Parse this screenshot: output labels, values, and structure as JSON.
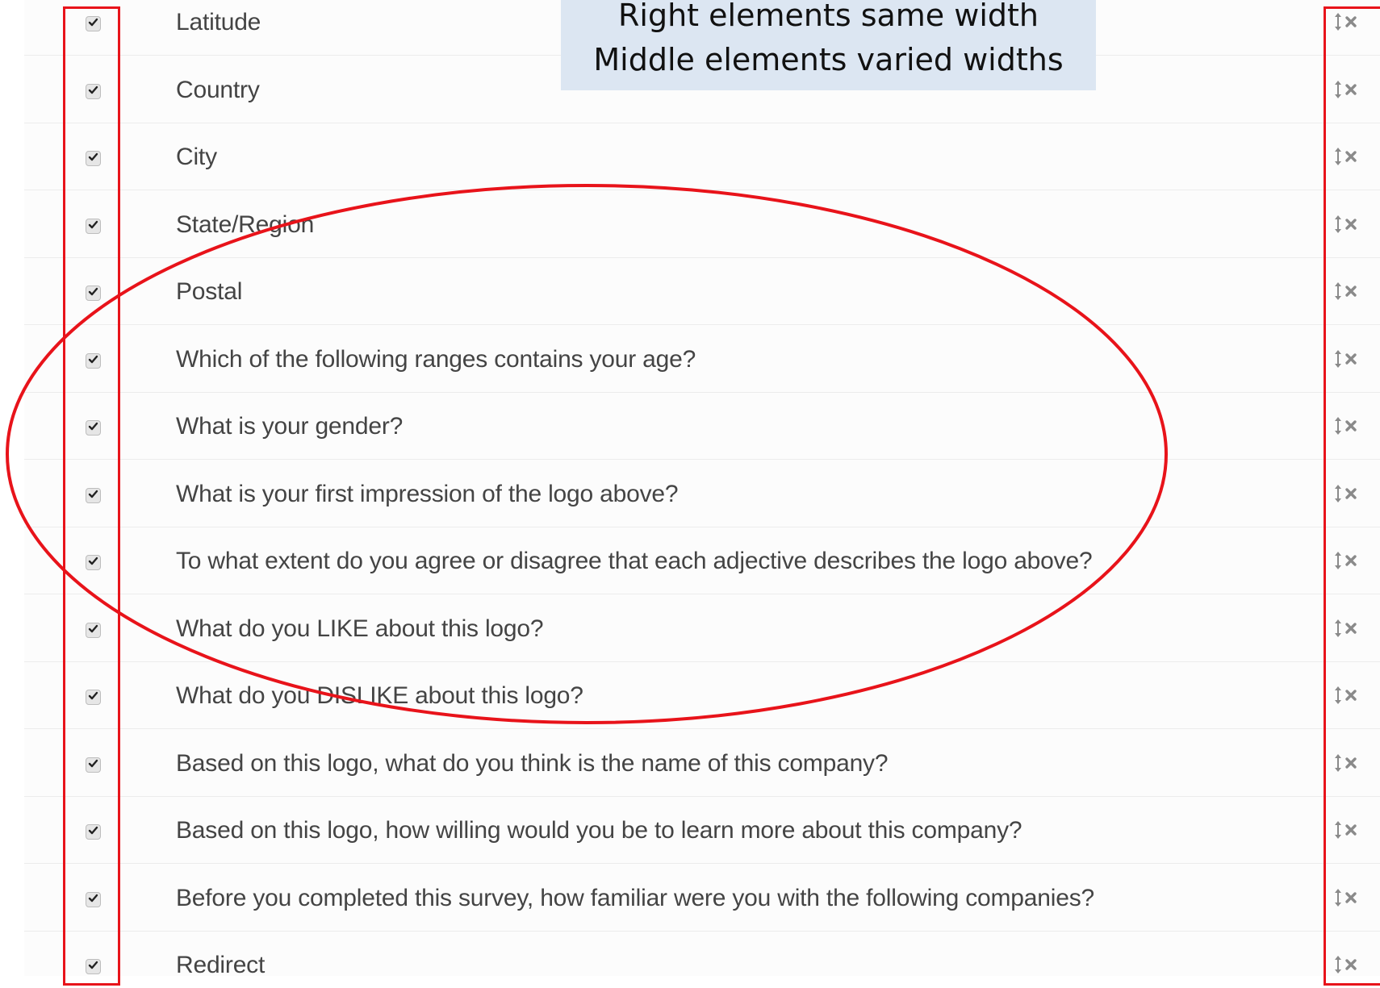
{
  "callout": {
    "line1": "Right elements same width",
    "line2": "Middle elements varied widths"
  },
  "icons": {
    "checkbox": "check-icon",
    "drag": "vertical-arrows-icon",
    "remove": "x-icon"
  },
  "colors": {
    "annotation_red": "#e8131a",
    "callout_bg": "#dce6f2",
    "label_text": "#444444"
  },
  "rows": [
    {
      "label": "Latitude",
      "checked": true
    },
    {
      "label": "Country",
      "checked": true
    },
    {
      "label": "City",
      "checked": true
    },
    {
      "label": "State/Region",
      "checked": true
    },
    {
      "label": "Postal",
      "checked": true
    },
    {
      "label": "Which of the following ranges contains your age?",
      "checked": true
    },
    {
      "label": "What is your gender?",
      "checked": true
    },
    {
      "label": "What is your first impression of the logo above?",
      "checked": true
    },
    {
      "label": "To what extent do you agree or disagree that each adjective describes the logo above?",
      "checked": true
    },
    {
      "label": "What do you LIKE about this logo?",
      "checked": true
    },
    {
      "label": "What do you DISLIKE about this logo?",
      "checked": true
    },
    {
      "label": "Based on this logo, what do you think is the name of this company?",
      "checked": true
    },
    {
      "label": "Based on this logo, how willing would you be to learn more about this company?",
      "checked": true
    },
    {
      "label": "Before you completed this survey, how familiar were you with the following companies?",
      "checked": true
    },
    {
      "label": "Redirect",
      "checked": true
    }
  ]
}
